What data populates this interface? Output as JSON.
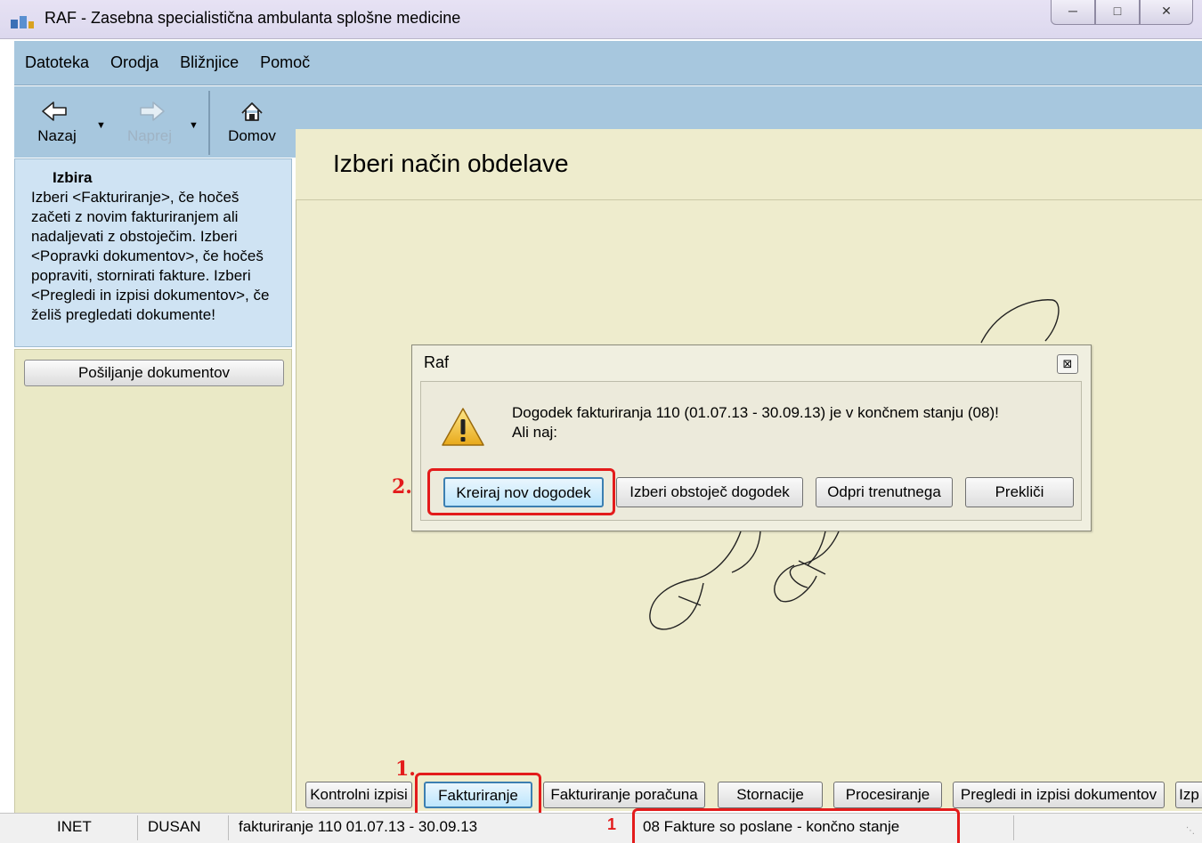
{
  "window": {
    "title": "RAF - Zasebna specialistična ambulanta splošne medicine",
    "controls": [
      "minimize-icon",
      "maximize-icon",
      "close-icon"
    ]
  },
  "menu": {
    "items": [
      "Datoteka",
      "Orodja",
      "Bližnjice",
      "Pomoč"
    ]
  },
  "toolbar": {
    "back_label": "Nazaj",
    "forward_label": "Naprej",
    "home_label": "Domov"
  },
  "help": {
    "title": "Izbira",
    "text": "Izberi <Fakturiranje>, če hočeš začeti z novim fakturiranjem ali nadaljevati z obstoječim. Izberi <Popravki dokumentov>, če hočeš popraviti, stornirati fakture. Izberi <Pregledi in izpisi dokumentov>, če želiš pregledati dokumente!"
  },
  "left_panel": {
    "send_button": "Pošiljanje dokumentov"
  },
  "main": {
    "title": "Izberi način obdelave"
  },
  "dialog": {
    "title": "Raf",
    "message_line1": "Dogodek fakturiranja 110 (01.07.13 - 30.09.13) je v končnem stanju (08)!",
    "message_line2": "Ali naj:",
    "buttons": {
      "create_new": "Kreiraj nov dogodek",
      "select_existing": "Izberi obstoječ dogodek",
      "open_current": "Odpri trenutnega",
      "cancel": "Prekliči"
    }
  },
  "tabs": [
    "Kontrolni izpisi",
    "Fakturiranje",
    "Fakturiranje poračuna",
    "Stornacije",
    "Procesiranje",
    "Pregledi in izpisi dokumentov",
    "Izp"
  ],
  "status": {
    "connection": "INET",
    "user": "DUSAN",
    "billing": "fakturiranje 110  01.07.13 - 30.09.13",
    "state_code": "1",
    "state_text": "08 Fakture so poslane - končno stanje"
  },
  "annotations": {
    "step1": "1.",
    "step2": "2."
  },
  "colors": {
    "menu_bg": "#a7c7de",
    "main_bg": "#eeeccd",
    "highlight_red": "#e31b1b"
  }
}
